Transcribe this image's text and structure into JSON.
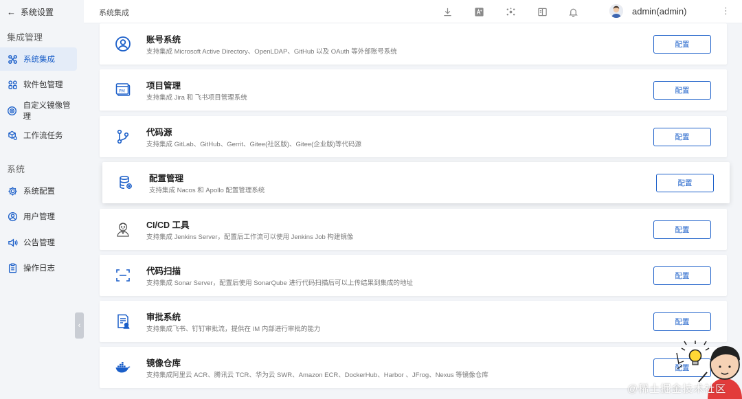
{
  "sidebar": {
    "back_label": "系统设置",
    "section1_title": "集成管理",
    "section2_title": "系统",
    "items": [
      {
        "label": "系统集成",
        "icon": "command-icon",
        "active": true
      },
      {
        "label": "软件包管理",
        "icon": "package-grid-icon",
        "active": false
      },
      {
        "label": "自定义镜像管理",
        "icon": "disc-image-icon",
        "active": false
      },
      {
        "label": "工作流任务",
        "icon": "cube-gear-icon",
        "active": false
      },
      {
        "label": "系统配置",
        "icon": "gear-icon",
        "active": false
      },
      {
        "label": "用户管理",
        "icon": "user-circle-icon",
        "active": false
      },
      {
        "label": "公告管理",
        "icon": "speaker-icon",
        "active": false
      },
      {
        "label": "操作日志",
        "icon": "clipboard-icon",
        "active": false
      }
    ],
    "collapse_glyph": "‹"
  },
  "header": {
    "breadcrumb": "系统集成",
    "username": "admin(admin)",
    "more_glyph": "⋮"
  },
  "integrations": [
    {
      "title": "账号系统",
      "desc": "支持集成 Microsoft Active Directory、OpenLDAP、GitHub 以及 OAuth 等外部账号系统",
      "button": "配置",
      "icon": "account-icon"
    },
    {
      "title": "项目管理",
      "desc": "支持集成 Jira 和 飞书项目管理系统",
      "button": "配置",
      "icon": "project-management-icon"
    },
    {
      "title": "代码源",
      "desc": "支持集成 GitLab、GitHub、Gerrit、Gitee(社区版)、Gitee(企业版)等代码源",
      "button": "配置",
      "icon": "git-branch-icon"
    },
    {
      "title": "配置管理",
      "desc": "支持集成 Nacos 和 Apollo 配置管理系统",
      "button": "配置",
      "icon": "database-gear-icon"
    },
    {
      "title": "CI/CD 工具",
      "desc": "支持集成 Jenkins Server，配置后工作流可以使用 Jenkins Job 构建镜像",
      "button": "配置",
      "icon": "jenkins-icon"
    },
    {
      "title": "代码扫描",
      "desc": "支持集成 Sonar Server，配置后使用 SonarQube 进行代码扫描后可以上传结果到集成的地址",
      "button": "配置",
      "icon": "scan-icon"
    },
    {
      "title": "审批系统",
      "desc": "支持集成飞书、钉钉审批流，提供在 IM 内部进行审批的能力",
      "button": "配置",
      "icon": "approval-icon"
    },
    {
      "title": "镜像仓库",
      "desc": "支持集成阿里云 ACR、腾讯云 TCR、华为云 SWR、Amazon ECR、DockerHub、Harbor 、JFrog、Nexus 等镜像仓库",
      "button": "配置",
      "icon": "docker-icon"
    }
  ],
  "watermark": "@稀土掘金技术社区",
  "colors": {
    "accent": "#1b5fc9",
    "active_bg": "#e4ecf8",
    "page_bg": "#f3f5f8"
  }
}
